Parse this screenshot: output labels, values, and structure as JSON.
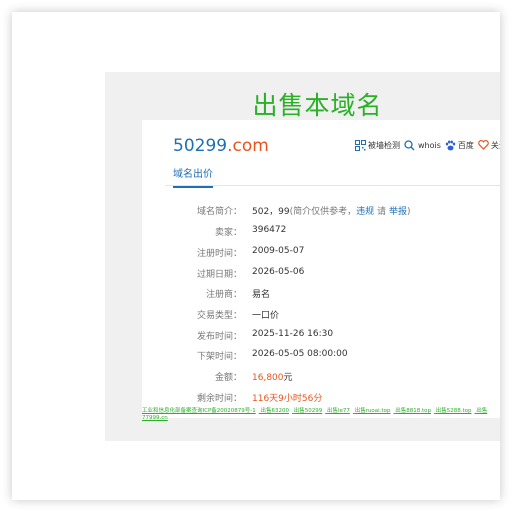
{
  "heading": "出售本域名",
  "domain": {
    "name": "50299",
    "tld": ".com"
  },
  "tools": [
    {
      "icon": "qrcode-icon",
      "label": "被墙检测"
    },
    {
      "icon": "search-icon",
      "label": "whois"
    },
    {
      "icon": "baidu-paw-icon",
      "label": "百度"
    },
    {
      "icon": "heart-icon",
      "label": "关注("
    }
  ],
  "tab": "域名出价",
  "info": {
    "intro_label": "域名简介：",
    "intro_value": "502，99",
    "intro_note": "(简介仅供参考，",
    "intro_link1": "违规",
    "intro_please": "请",
    "intro_link2": "举报",
    "intro_close": ")",
    "seller_label": "卖家：",
    "seller_value": "396472",
    "reg_label": "注册时间：",
    "reg_value": "2009-05-07",
    "exp_label": "过期日期：",
    "exp_value": "2026-05-06",
    "registrar_label": "注册商：",
    "registrar_value": "易名",
    "type_label": "交易类型：",
    "type_value": "一口价",
    "pub_label": "发布时间：",
    "pub_value": "2025-11-26 16:30",
    "off_label": "下架时间：",
    "off_value": "2026-05-05 08:00:00",
    "amount_label": "金额：",
    "amount_value": "16,800",
    "amount_unit": "元",
    "remain_label": "剩余时间：",
    "remain_value": "116天9小时56分"
  },
  "footer": {
    "icp": "工业和信息化部备案查询ICP备20020879号-1",
    "links": [
      "出售63200",
      "出售50299",
      "出售le77",
      "出售ruoai.top",
      "出售8818.top",
      "出售5288.top",
      "出售77999.cn"
    ]
  },
  "colors": {
    "green": "#2bb028",
    "blue": "#1f6fb5",
    "orange": "#e8541e"
  }
}
